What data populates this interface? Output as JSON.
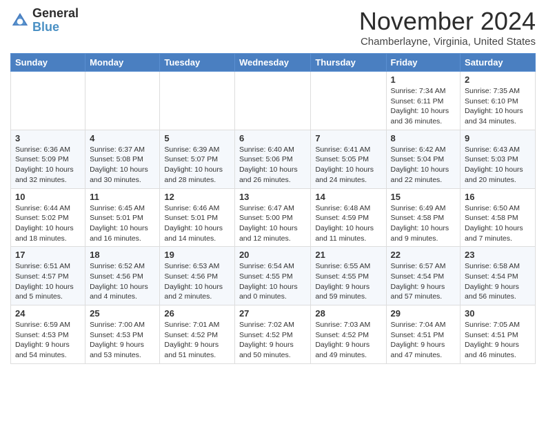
{
  "logo": {
    "line1": "General",
    "line2": "Blue"
  },
  "title": "November 2024",
  "location": "Chamberlayne, Virginia, United States",
  "days_of_week": [
    "Sunday",
    "Monday",
    "Tuesday",
    "Wednesday",
    "Thursday",
    "Friday",
    "Saturday"
  ],
  "weeks": [
    [
      {
        "num": "",
        "info": ""
      },
      {
        "num": "",
        "info": ""
      },
      {
        "num": "",
        "info": ""
      },
      {
        "num": "",
        "info": ""
      },
      {
        "num": "",
        "info": ""
      },
      {
        "num": "1",
        "info": "Sunrise: 7:34 AM\nSunset: 6:11 PM\nDaylight: 10 hours\nand 36 minutes."
      },
      {
        "num": "2",
        "info": "Sunrise: 7:35 AM\nSunset: 6:10 PM\nDaylight: 10 hours\nand 34 minutes."
      }
    ],
    [
      {
        "num": "3",
        "info": "Sunrise: 6:36 AM\nSunset: 5:09 PM\nDaylight: 10 hours\nand 32 minutes."
      },
      {
        "num": "4",
        "info": "Sunrise: 6:37 AM\nSunset: 5:08 PM\nDaylight: 10 hours\nand 30 minutes."
      },
      {
        "num": "5",
        "info": "Sunrise: 6:39 AM\nSunset: 5:07 PM\nDaylight: 10 hours\nand 28 minutes."
      },
      {
        "num": "6",
        "info": "Sunrise: 6:40 AM\nSunset: 5:06 PM\nDaylight: 10 hours\nand 26 minutes."
      },
      {
        "num": "7",
        "info": "Sunrise: 6:41 AM\nSunset: 5:05 PM\nDaylight: 10 hours\nand 24 minutes."
      },
      {
        "num": "8",
        "info": "Sunrise: 6:42 AM\nSunset: 5:04 PM\nDaylight: 10 hours\nand 22 minutes."
      },
      {
        "num": "9",
        "info": "Sunrise: 6:43 AM\nSunset: 5:03 PM\nDaylight: 10 hours\nand 20 minutes."
      }
    ],
    [
      {
        "num": "10",
        "info": "Sunrise: 6:44 AM\nSunset: 5:02 PM\nDaylight: 10 hours\nand 18 minutes."
      },
      {
        "num": "11",
        "info": "Sunrise: 6:45 AM\nSunset: 5:01 PM\nDaylight: 10 hours\nand 16 minutes."
      },
      {
        "num": "12",
        "info": "Sunrise: 6:46 AM\nSunset: 5:01 PM\nDaylight: 10 hours\nand 14 minutes."
      },
      {
        "num": "13",
        "info": "Sunrise: 6:47 AM\nSunset: 5:00 PM\nDaylight: 10 hours\nand 12 minutes."
      },
      {
        "num": "14",
        "info": "Sunrise: 6:48 AM\nSunset: 4:59 PM\nDaylight: 10 hours\nand 11 minutes."
      },
      {
        "num": "15",
        "info": "Sunrise: 6:49 AM\nSunset: 4:58 PM\nDaylight: 10 hours\nand 9 minutes."
      },
      {
        "num": "16",
        "info": "Sunrise: 6:50 AM\nSunset: 4:58 PM\nDaylight: 10 hours\nand 7 minutes."
      }
    ],
    [
      {
        "num": "17",
        "info": "Sunrise: 6:51 AM\nSunset: 4:57 PM\nDaylight: 10 hours\nand 5 minutes."
      },
      {
        "num": "18",
        "info": "Sunrise: 6:52 AM\nSunset: 4:56 PM\nDaylight: 10 hours\nand 4 minutes."
      },
      {
        "num": "19",
        "info": "Sunrise: 6:53 AM\nSunset: 4:56 PM\nDaylight: 10 hours\nand 2 minutes."
      },
      {
        "num": "20",
        "info": "Sunrise: 6:54 AM\nSunset: 4:55 PM\nDaylight: 10 hours\nand 0 minutes."
      },
      {
        "num": "21",
        "info": "Sunrise: 6:55 AM\nSunset: 4:55 PM\nDaylight: 9 hours\nand 59 minutes."
      },
      {
        "num": "22",
        "info": "Sunrise: 6:57 AM\nSunset: 4:54 PM\nDaylight: 9 hours\nand 57 minutes."
      },
      {
        "num": "23",
        "info": "Sunrise: 6:58 AM\nSunset: 4:54 PM\nDaylight: 9 hours\nand 56 minutes."
      }
    ],
    [
      {
        "num": "24",
        "info": "Sunrise: 6:59 AM\nSunset: 4:53 PM\nDaylight: 9 hours\nand 54 minutes."
      },
      {
        "num": "25",
        "info": "Sunrise: 7:00 AM\nSunset: 4:53 PM\nDaylight: 9 hours\nand 53 minutes."
      },
      {
        "num": "26",
        "info": "Sunrise: 7:01 AM\nSunset: 4:52 PM\nDaylight: 9 hours\nand 51 minutes."
      },
      {
        "num": "27",
        "info": "Sunrise: 7:02 AM\nSunset: 4:52 PM\nDaylight: 9 hours\nand 50 minutes."
      },
      {
        "num": "28",
        "info": "Sunrise: 7:03 AM\nSunset: 4:52 PM\nDaylight: 9 hours\nand 49 minutes."
      },
      {
        "num": "29",
        "info": "Sunrise: 7:04 AM\nSunset: 4:51 PM\nDaylight: 9 hours\nand 47 minutes."
      },
      {
        "num": "30",
        "info": "Sunrise: 7:05 AM\nSunset: 4:51 PM\nDaylight: 9 hours\nand 46 minutes."
      }
    ]
  ]
}
